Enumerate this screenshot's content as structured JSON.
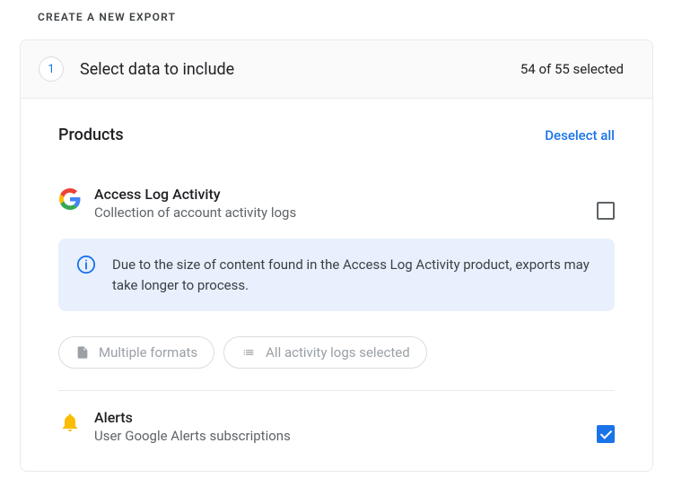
{
  "page": {
    "heading": "CREATE A NEW EXPORT"
  },
  "step": {
    "number": "1",
    "title": "Select data to include",
    "selection_count": "54 of 55 selected"
  },
  "section": {
    "title": "Products",
    "deselect_label": "Deselect all"
  },
  "products": [
    {
      "name": "Access Log Activity",
      "description": "Collection of account activity logs",
      "checked": false,
      "icon": "google-g"
    },
    {
      "name": "Alerts",
      "description": "User Google Alerts subscriptions",
      "checked": true,
      "icon": "bell"
    }
  ],
  "info_banner": {
    "message": "Due to the size of content found in the Access Log Activity product, exports may take longer to process."
  },
  "chips": {
    "formats": "Multiple formats",
    "content": "All activity logs selected"
  }
}
